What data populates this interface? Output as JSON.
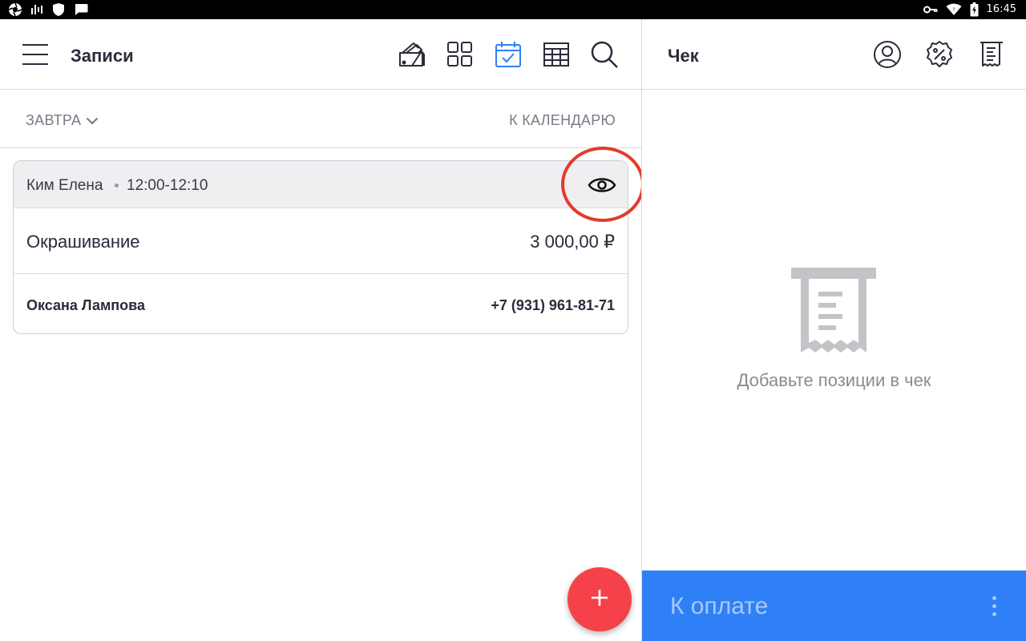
{
  "status_bar": {
    "time": "16:45",
    "icons": [
      "aperture-icon",
      "signal-bars-icon",
      "shield-icon",
      "message-icon",
      "key-icon",
      "wifi-icon",
      "battery-charging-icon"
    ]
  },
  "left_toolbar": {
    "title": "Записи",
    "icons": [
      "menu-icon",
      "color-palette-icon",
      "grid-icon",
      "calendar-check-icon",
      "table-icon",
      "search-icon"
    ],
    "active_icon": "calendar-check-icon"
  },
  "date_bar": {
    "selected_date": "ЗАВТРА",
    "calendar_link": "К КАЛЕНДАРЮ"
  },
  "record": {
    "client": "Ким Елена",
    "time_range": "12:00-12:10",
    "service": "Окрашивание",
    "price": "3 000,00 ₽",
    "master": "Оксана Лампова",
    "phone": "+7 (931) 961-81-71"
  },
  "fab": {
    "icon": "plus-icon"
  },
  "receipt_panel": {
    "title": "Чек",
    "icons": [
      "user-circle-icon",
      "discount-badge-icon",
      "receipt-list-icon"
    ],
    "empty_message": "Добавьте позиции в чек",
    "pay_label": "К оплате"
  },
  "colors": {
    "accent_blue": "#2f80f6",
    "fab_red": "#f5424a",
    "highlight_red": "#e53a2b",
    "text_dark": "#2b2b3a",
    "text_muted": "#7b7b86"
  }
}
